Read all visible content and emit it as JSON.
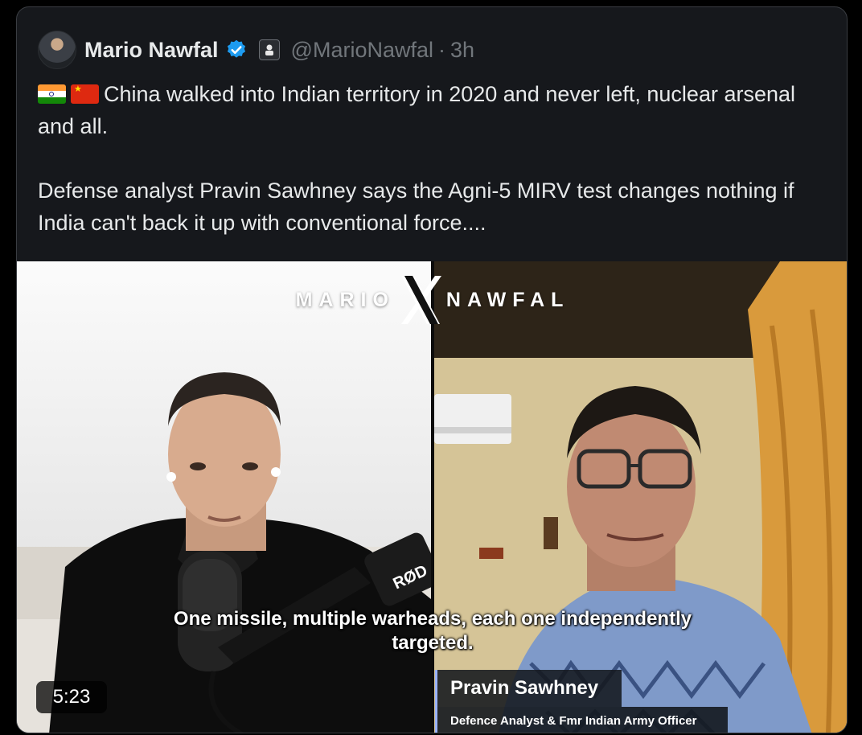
{
  "tweet": {
    "author_name": "Mario Nawfal",
    "handle": "@MarioNawfal",
    "separator": "·",
    "timestamp": "3h",
    "flags": [
      "india-flag-icon",
      "china-flag-icon"
    ],
    "text_line1": "China walked into Indian territory in 2020 and never left, nuclear arsenal and all.",
    "text_line2": "Defense analyst Pravin Sawhney says the Agni-5 MIRV test changes nothing if India can't back it up with conventional force...."
  },
  "video": {
    "brand_left": "MARIO",
    "brand_right": "NAWFAL",
    "subtitle": "One missile, multiple warheads, each one independently targeted.",
    "duration": "5:23",
    "guest_name": "Pravin Sawhney",
    "guest_title": "Defence Analyst & Fmr Indian Army Officer"
  },
  "colors": {
    "background": "#000000",
    "card": "#16181c",
    "text": "#e7e9ea",
    "muted": "#71767b",
    "verified": "#1d9bf0"
  }
}
